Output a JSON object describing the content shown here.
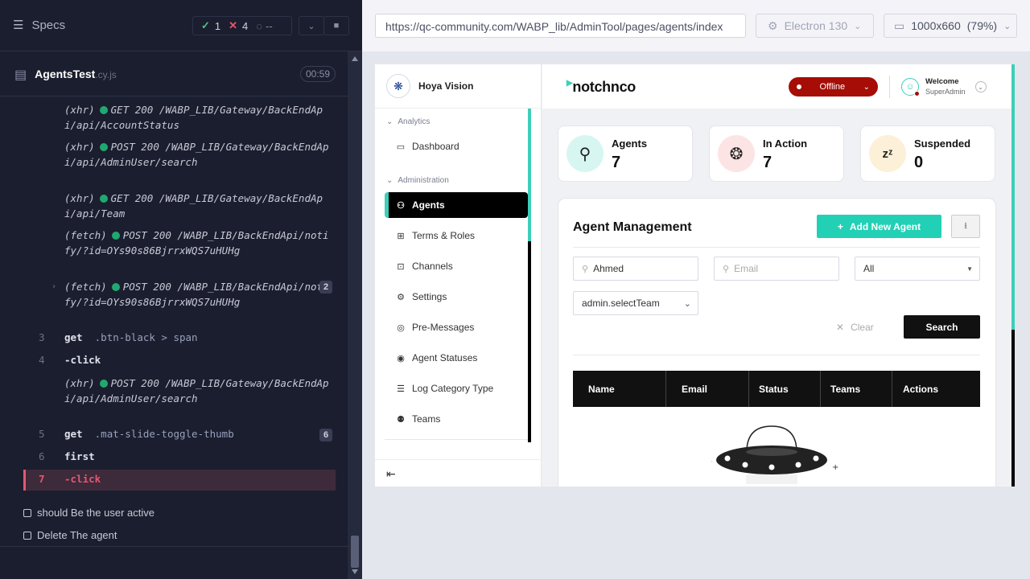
{
  "cypress": {
    "specs_label": "Specs",
    "stats": {
      "passed": "1",
      "failed": "4",
      "pending": "--"
    },
    "spec": {
      "name": "AgentsTest",
      "ext": ".cy.js",
      "duration": "00:59"
    },
    "commands": [
      {
        "num": "",
        "kind": "(xhr)",
        "text": "GET 200 /WABP_LIB/Gateway/BackEndApi/api/AccountStatus",
        "badge": ""
      },
      {
        "num": "",
        "kind": "(xhr)",
        "text": "POST 200 /WABP_LIB/Gateway/BackEndApi/api/AdminUser/search",
        "badge": ""
      },
      {
        "num": "",
        "kind": "(xhr)",
        "text": "GET 200 /WABP_LIB/Gateway/BackEndApi/api/Team",
        "badge": ""
      },
      {
        "num": "",
        "kind": "(fetch)",
        "text": "POST 200 /WABP_LIB/BackEndApi/notify/?id=OYs90s86BjrrxWQS7uHUHg",
        "badge": ""
      },
      {
        "num": "",
        "kind": "(fetch)",
        "text": "POST 200 /WABP_LIB/BackEndApi/notify/?id=OYs90s86BjrrxWQS7uHUHg",
        "badge": "2"
      },
      {
        "num": "3",
        "kw": "get",
        "sel": ".btn-black > span",
        "badge": ""
      },
      {
        "num": "4",
        "kw": "-click",
        "sel": "",
        "badge": ""
      },
      {
        "num": "",
        "kind": "(xhr)",
        "text": "POST 200 /WABP_LIB/Gateway/BackEndApi/api/AdminUser/search",
        "badge": ""
      },
      {
        "num": "5",
        "kw": "get",
        "sel": ".mat-slide-toggle-thumb",
        "badge": "6"
      },
      {
        "num": "6",
        "kw": "first",
        "sel": "",
        "badge": ""
      }
    ],
    "failed_command": {
      "num": "7",
      "text": "-click"
    },
    "tests": [
      "should Be the user active",
      "Delete The agent"
    ]
  },
  "browser_bar": {
    "url": "https://qc-community.com/WABP_lib/AdminTool/pages/agents/index",
    "browser": "Electron 130",
    "viewport": "1000x660",
    "zoom": "(79%)"
  },
  "app": {
    "brand": "Hoya Vision",
    "logo_text": "notchnco",
    "sections": [
      "Analytics",
      "Administration"
    ],
    "nav": [
      "Dashboard",
      "Agents",
      "Terms & Roles",
      "Channels",
      "Settings",
      "Pre-Messages",
      "Agent Statuses",
      "Log Category Type",
      "Teams"
    ],
    "status": "Offline",
    "welcome": "Welcome",
    "role": "SuperAdmin",
    "cards": [
      {
        "label": "Agents",
        "value": "7"
      },
      {
        "label": "In Action",
        "value": "7"
      },
      {
        "label": "Suspended",
        "value": "0"
      }
    ],
    "panel": {
      "title": "Agent Management",
      "add_label": "Add New Agent",
      "name_value": "Ahmed",
      "email_placeholder": "Email",
      "status_value": "All",
      "team_value": "admin.selectTeam",
      "clear_label": "Clear",
      "search_label": "Search",
      "columns": [
        "Name",
        "Email",
        "Status",
        "Teams",
        "Actions"
      ]
    },
    "colors": {
      "accent": "#22d0b5",
      "offline": "#a50d06"
    }
  }
}
